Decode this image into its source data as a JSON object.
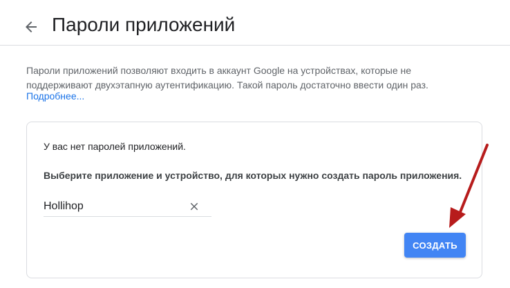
{
  "header": {
    "title": "Пароли приложений",
    "back_icon": "arrow-left-icon"
  },
  "description": {
    "text": "Пароли приложений позволяют входить в аккаунт Google на устройствах, которые не поддерживают двухэтапную аутентификацию. Такой пароль достаточно ввести один раз.",
    "learn_more": "Подробнее..."
  },
  "card": {
    "empty_text": "У вас нет паролей приложений.",
    "instruction": "Выберите приложение и устройство, для которых нужно создать пароль приложения.",
    "app_name_value": "Hollihop",
    "clear_icon": "close-icon",
    "create_label": "СОЗДАТЬ"
  },
  "colors": {
    "accent": "#1a73e8",
    "button": "#4285f4",
    "annotation_arrow": "#b71c1c"
  }
}
